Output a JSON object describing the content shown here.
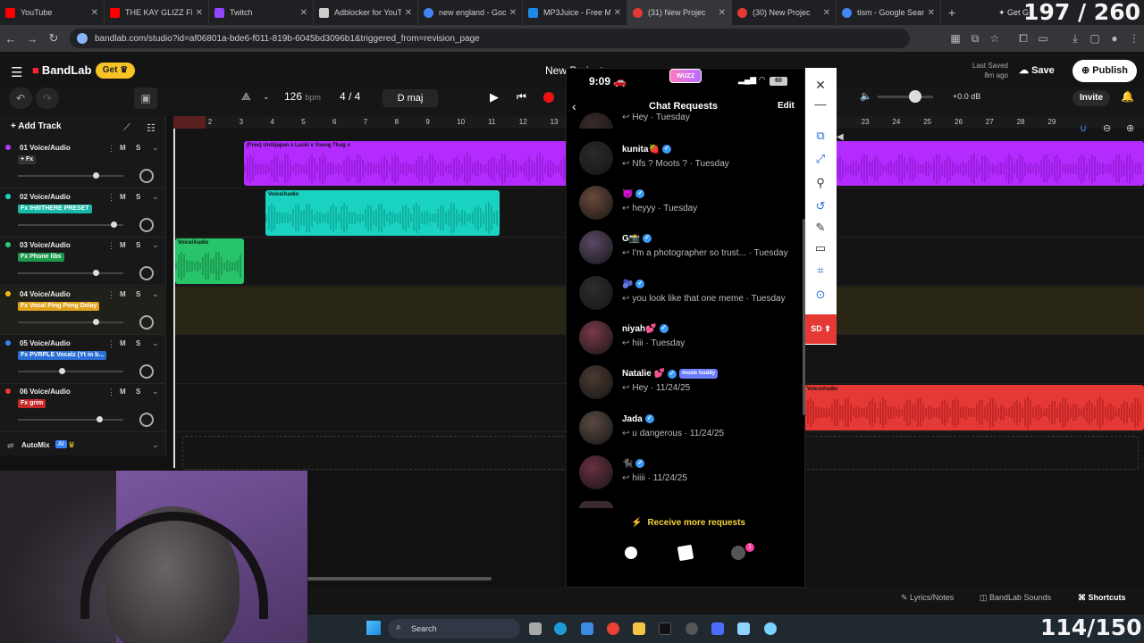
{
  "browser": {
    "tabs": [
      {
        "label": "YouTube",
        "color": "#ff0000"
      },
      {
        "label": "THE KAY GLIZZ FRE",
        "color": "#ff0000"
      },
      {
        "label": "Twitch",
        "color": "#9146ff"
      },
      {
        "label": "Adblocker for YouTu",
        "color": "#cccccc"
      },
      {
        "label": "new england - Goo",
        "color": "#4285f4"
      },
      {
        "label": "MP3Juice - Free MP",
        "color": "#1e88e5"
      },
      {
        "label": "(31) New Projec",
        "color": "#e53935",
        "active": true
      },
      {
        "label": "(30) New Projec",
        "color": "#e53935"
      },
      {
        "label": "tism - Google Sear",
        "color": "#4285f4"
      }
    ],
    "get_gemini": "Get G",
    "url": "bandlab.com/studio?id=af06801a-bde6-f011-819b-6045bd3096b1&triggered_from=revision_page"
  },
  "overlay": {
    "counter_top": "197 / 260",
    "counter_bottom": "114/150"
  },
  "app": {
    "logo": "BandLab",
    "get_label": "Get",
    "project_title": "New Project",
    "last_saved_label": "Last Saved",
    "last_saved_value": "8m ago",
    "save_label": "Save",
    "publish_label": "Publish",
    "invite_label": "Invite",
    "tempo": "126",
    "tempo_unit": "bpm",
    "time_signature": "4 / 4",
    "key": "D maj",
    "volume": "+0.0 dB",
    "add_track_label": "Add Track",
    "automix_label": "AutoMix",
    "ai_label": "AI"
  },
  "tracks": [
    {
      "name": "01  Voice/Audio",
      "fx": "+ Fx",
      "fx_color": "#333333",
      "color": "#b03cff",
      "fader": 0.72,
      "mute": "M",
      "solo": "S"
    },
    {
      "name": "02  Voice/Audio",
      "fx": "Fx IH8ITHERE PRESET",
      "fx_color": "#17b8a6",
      "color": "#1fd3c1",
      "fader": 0.9,
      "mute": "M",
      "solo": "S"
    },
    {
      "name": "03  Voice/Audio",
      "fx": "Fx Phone libs",
      "fx_color": "#1c9a4c",
      "color": "#2ecc71",
      "fader": 0.72,
      "mute": "M",
      "solo": "S"
    },
    {
      "name": "04  Voice/Audio",
      "fx": "Fx Vocal Ping Pong Delay",
      "fx_color": "#e1a21b",
      "color": "#f2b81a",
      "fader": 0.72,
      "mute": "M",
      "solo": "S"
    },
    {
      "name": "05  Voice/Audio",
      "fx": "Fx PVRPLE Vocalz (Yt in b...",
      "fx_color": "#2b6fd6",
      "color": "#3b82f6",
      "fader": 0.4,
      "mute": "M",
      "solo": "S"
    },
    {
      "name": "06  Voice/Audio",
      "fx": "Fx grim",
      "fx_color": "#c62828",
      "color": "#e53935",
      "fader": 0.76,
      "mute": "M",
      "solo": "S"
    }
  ],
  "ruler": [
    "1",
    "2",
    "3",
    "4",
    "5",
    "6",
    "7",
    "8",
    "9",
    "10",
    "11",
    "12",
    "13",
    "",
    "",
    "",
    "",
    "",
    "",
    "",
    "",
    "",
    "23",
    "24",
    "25",
    "26",
    "27",
    "28",
    "29"
  ],
  "clips": {
    "c1": "(Free) Untiljapan x Lucki x Young Thug x",
    "c2": "Voice/Audio",
    "c3": "Voice/Audio",
    "c6": "Voice/Audio"
  },
  "phone": {
    "time": "9:09",
    "app_badge": "WUZZ",
    "battery": "60",
    "title": "Chat Requests",
    "edit_label": "Edit",
    "chats": [
      {
        "name": "",
        "msg": "Hey · Tuesday",
        "verified": false,
        "color": "#3a2a2a"
      },
      {
        "name": "kunita🍓",
        "msg": "Nfs ? Moots ? · Tuesday",
        "verified": true,
        "color": "#2a2a2a"
      },
      {
        "name": "😈",
        "msg": "heyyy · Tuesday",
        "verified": true,
        "color": "#6b4a3a"
      },
      {
        "name": "G📸",
        "msg": "I'm a photographer so trust... · Tuesday",
        "verified": true,
        "color": "#5a4a66"
      },
      {
        "name": "🫐",
        "msg": "you look like that one meme · Tuesday",
        "verified": true,
        "color": "#2d2d2d"
      },
      {
        "name": "niyah💕",
        "msg": "hiii · Tuesday",
        "verified": true,
        "color": "#7a3a4a"
      },
      {
        "name": "Natalie 💕",
        "msg": "Hey · 11/24/25",
        "verified": true,
        "color": "#4a3a30",
        "tag": "music buddy"
      },
      {
        "name": "Jada",
        "msg": "u dangerous · 11/24/25",
        "verified": true,
        "color": "#5a4a40"
      },
      {
        "name": "🐈‍⬛",
        "msg": "hiiii · 11/24/25",
        "verified": true,
        "color": "#6a3040"
      }
    ],
    "more_requests": "Receive more requests",
    "notif_count": "1"
  },
  "sidepanel": {
    "sd_label": "SD"
  },
  "footer": {
    "lyrics": "Lyrics/Notes",
    "sounds": "BandLab Sounds",
    "shortcuts": "Shortcuts"
  },
  "taskbar": {
    "search": "Search"
  }
}
